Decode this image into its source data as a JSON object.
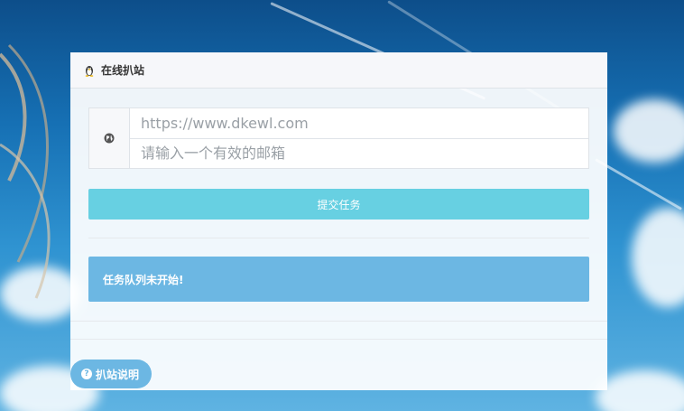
{
  "header": {
    "title": "在线扒站",
    "icon": "penguin-icon"
  },
  "form": {
    "addon_icon": "globe-icon",
    "url_placeholder": "https://www.dkewl.com",
    "email_placeholder": "请输入一个有效的邮箱",
    "submit_label": "提交任务"
  },
  "status": {
    "message": "任务队列未开始!"
  },
  "footer": {
    "help_label": "扒站说明",
    "help_icon": "question-circle-icon"
  },
  "colors": {
    "submit_bg": "#67d0e2",
    "alert_bg": "#6cb7e3",
    "help_bg": "#6cb7e3"
  }
}
